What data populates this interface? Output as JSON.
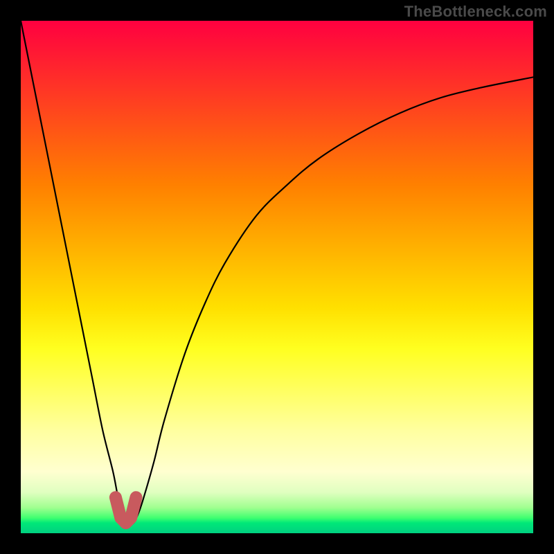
{
  "watermark": "TheBottleneck.com",
  "colors": {
    "curve": "#000000",
    "u_mark": "#c85a5e",
    "frame": "#000000"
  },
  "chart_data": {
    "type": "line",
    "title": "",
    "xlabel": "",
    "ylabel": "",
    "xlim": [
      0,
      100
    ],
    "ylim": [
      0,
      100
    ],
    "grid": false,
    "legend": "none",
    "series": [
      {
        "name": "bottleneck-curve",
        "x": [
          0,
          4,
          8,
          12,
          14,
          16,
          18,
          19,
          20,
          21,
          22,
          23,
          24,
          26,
          28,
          32,
          36,
          40,
          46,
          52,
          58,
          66,
          74,
          82,
          90,
          100
        ],
        "values": [
          100,
          80,
          60,
          40,
          30,
          20,
          12,
          7,
          4,
          2,
          2,
          4,
          7,
          14,
          22,
          35,
          45,
          53,
          62,
          68,
          73,
          78,
          82,
          85,
          87,
          89
        ]
      }
    ],
    "annotations": [
      {
        "name": "u-marker",
        "type": "path",
        "color": "#c85a5e",
        "x": [
          18.5,
          19.5,
          20.5,
          21.5,
          22.5
        ],
        "values": [
          7,
          3,
          2,
          3,
          7
        ]
      }
    ],
    "background_gradient": {
      "type": "vertical",
      "stops": [
        {
          "pos": 0.0,
          "color": "#ff0040"
        },
        {
          "pos": 0.25,
          "color": "#ff6010"
        },
        {
          "pos": 0.5,
          "color": "#ffe000"
        },
        {
          "pos": 0.8,
          "color": "#ffffb0"
        },
        {
          "pos": 0.95,
          "color": "#80ff80"
        },
        {
          "pos": 1.0,
          "color": "#00d080"
        }
      ]
    }
  }
}
